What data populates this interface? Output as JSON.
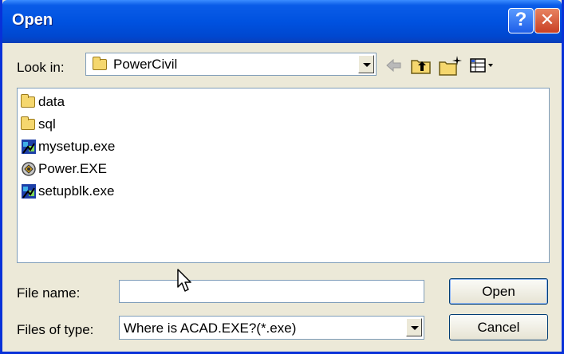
{
  "window": {
    "title": "Open",
    "help_glyph": "?",
    "close_glyph": "✕",
    "title_gradient_color": "#0052e0"
  },
  "lookin": {
    "label": "Look in:",
    "value": "PowerCivil",
    "icon": "folder-icon"
  },
  "toolbar": {
    "icons": [
      "back-arrow-icon",
      "up-folder-icon",
      "new-folder-icon",
      "view-menu-icon"
    ]
  },
  "files": [
    {
      "name": "data",
      "icon": "folder-icon"
    },
    {
      "name": "sql",
      "icon": "folder-icon"
    },
    {
      "name": "mysetup.exe",
      "icon": "installer-icon"
    },
    {
      "name": "Power.EXE",
      "icon": "app-icon"
    },
    {
      "name": "setupblk.exe",
      "icon": "installer-icon"
    }
  ],
  "filename": {
    "label": "File name:",
    "value": ""
  },
  "filetype": {
    "label": "Files of type:",
    "value": "Where is ACAD.EXE?(*.exe)"
  },
  "buttons": {
    "open": "Open",
    "cancel": "Cancel"
  }
}
